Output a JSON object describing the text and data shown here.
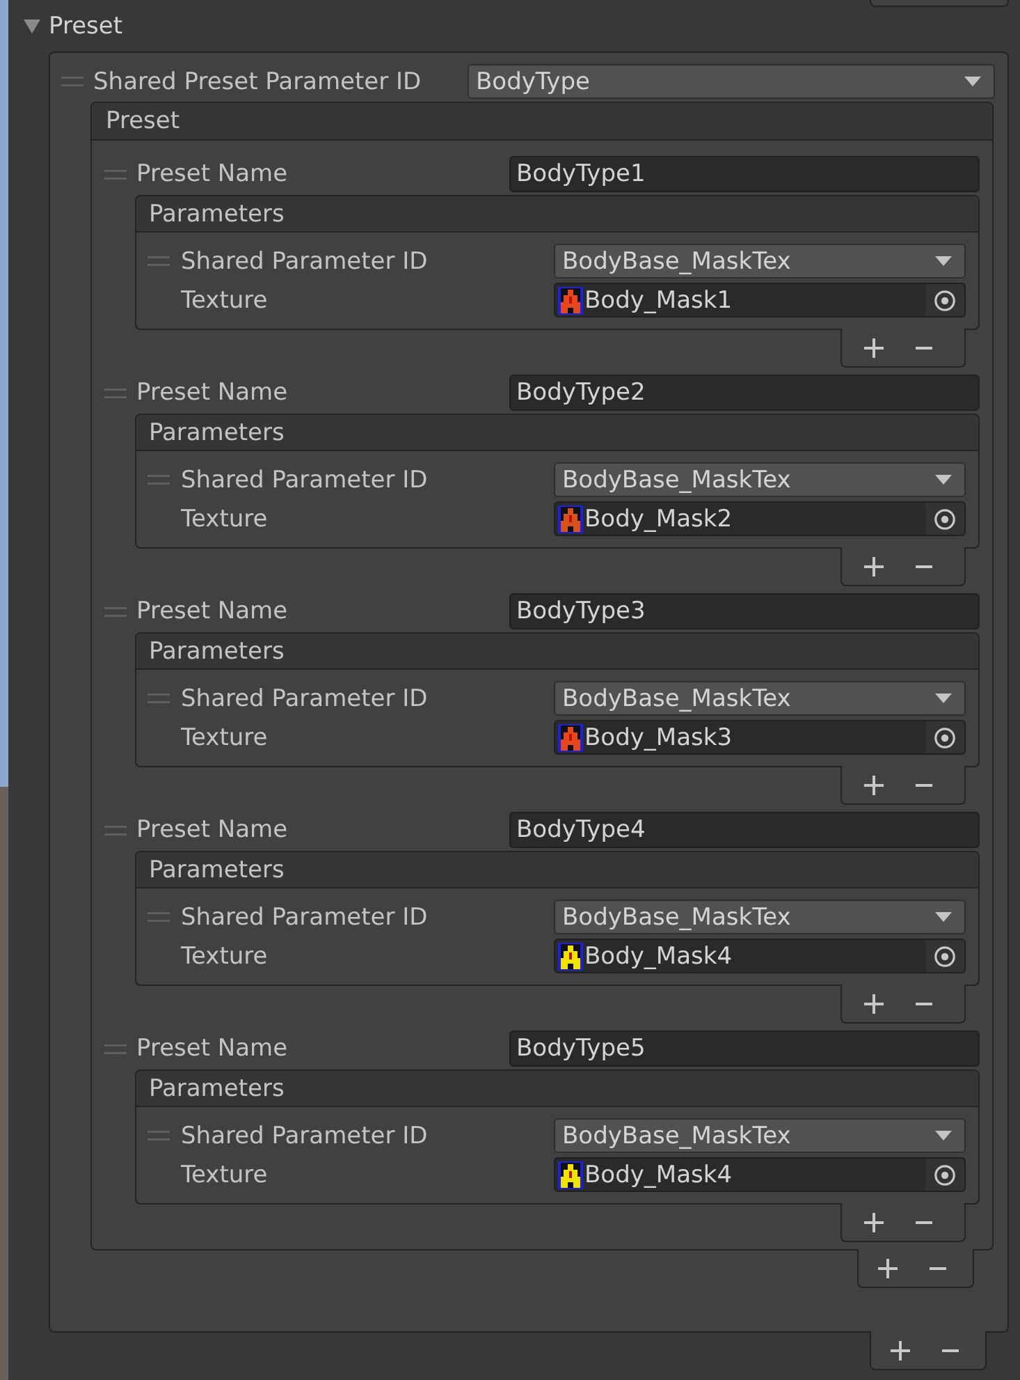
{
  "foldout": {
    "label": "Preset",
    "expanded": true
  },
  "shared_preset_parameter": {
    "label": "Shared Preset Parameter ID",
    "value": "BodyType"
  },
  "preset_list": {
    "header": "Preset",
    "items": [
      {
        "name_label": "Preset Name",
        "name": "BodyType1",
        "parameters": {
          "header": "Parameters",
          "items": [
            {
              "id_label": "Shared Parameter ID",
              "id": "BodyBase_MaskTex",
              "texture_label": "Texture",
              "texture": "Body_Mask1",
              "color": "#e8461c"
            }
          ]
        }
      },
      {
        "name_label": "Preset Name",
        "name": "BodyType2",
        "parameters": {
          "header": "Parameters",
          "items": [
            {
              "id_label": "Shared Parameter ID",
              "id": "BodyBase_MaskTex",
              "texture_label": "Texture",
              "texture": "Body_Mask2",
              "color": "#d8501a"
            }
          ]
        }
      },
      {
        "name_label": "Preset Name",
        "name": "BodyType3",
        "parameters": {
          "header": "Parameters",
          "items": [
            {
              "id_label": "Shared Parameter ID",
              "id": "BodyBase_MaskTex",
              "texture_label": "Texture",
              "texture": "Body_Mask3",
              "color": "#e8461c"
            }
          ]
        }
      },
      {
        "name_label": "Preset Name",
        "name": "BodyType4",
        "parameters": {
          "header": "Parameters",
          "items": [
            {
              "id_label": "Shared Parameter ID",
              "id": "BodyBase_MaskTex",
              "texture_label": "Texture",
              "texture": "Body_Mask4",
              "color": "#f2e200"
            }
          ]
        }
      },
      {
        "name_label": "Preset Name",
        "name": "BodyType5",
        "parameters": {
          "header": "Parameters",
          "items": [
            {
              "id_label": "Shared Parameter ID",
              "id": "BodyBase_MaskTex",
              "texture_label": "Texture",
              "texture": "Body_Mask4",
              "color": "#f2e200"
            }
          ]
        }
      }
    ]
  }
}
